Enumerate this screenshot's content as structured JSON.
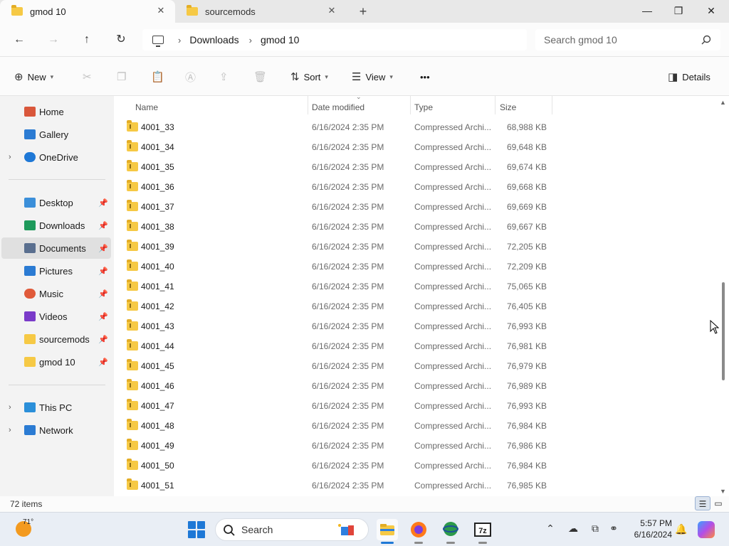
{
  "tabs": [
    {
      "label": "gmod 10",
      "active": true
    },
    {
      "label": "sourcemods",
      "active": false
    }
  ],
  "window_controls": {
    "minimize": "—",
    "maximize": "❐",
    "close": "✕"
  },
  "address": {
    "breadcrumbs": [
      "Downloads",
      "gmod 10"
    ],
    "search_placeholder": "Search gmod 10"
  },
  "commandbar": {
    "new": "New",
    "sort": "Sort",
    "view": "View",
    "more": "•••",
    "details": "Details"
  },
  "sidebar": {
    "top": [
      {
        "label": "Home",
        "icon": "home-icon",
        "color": "#d9573b"
      },
      {
        "label": "Gallery",
        "icon": "gallery-icon",
        "color": "#2b7bd3"
      },
      {
        "label": "OneDrive",
        "icon": "cloud-icon",
        "color": "#1e78d6",
        "expandable": true
      }
    ],
    "quick": [
      {
        "label": "Desktop",
        "icon": "desktop-icon",
        "color": "#3b8fd9",
        "pinned": true
      },
      {
        "label": "Downloads",
        "icon": "download-icon",
        "color": "#1e9a5b",
        "pinned": true
      },
      {
        "label": "Documents",
        "icon": "document-icon",
        "color": "#5a6f8f",
        "pinned": true,
        "selected": true
      },
      {
        "label": "Pictures",
        "icon": "pictures-icon",
        "color": "#2b7bd3",
        "pinned": true
      },
      {
        "label": "Music",
        "icon": "music-icon",
        "color": "#e05a3a",
        "pinned": true
      },
      {
        "label": "Videos",
        "icon": "videos-icon",
        "color": "#7a3bc9",
        "pinned": true
      },
      {
        "label": "sourcemods",
        "icon": "folder-icon",
        "color": "#f6c945",
        "pinned": true
      },
      {
        "label": "gmod 10",
        "icon": "folder-icon",
        "color": "#f6c945",
        "pinned": true
      }
    ],
    "bottom": [
      {
        "label": "This PC",
        "icon": "pc-icon",
        "color": "#2b8fd9",
        "expandable": true
      },
      {
        "label": "Network",
        "icon": "network-icon",
        "color": "#2b7bd3",
        "expandable": true
      }
    ]
  },
  "columns": {
    "name": "Name",
    "date": "Date modified",
    "type": "Type",
    "size": "Size"
  },
  "files": [
    {
      "name": "4001_33",
      "date": "6/16/2024 2:35 PM",
      "type": "Compressed Archi...",
      "size": "68,988 KB"
    },
    {
      "name": "4001_34",
      "date": "6/16/2024 2:35 PM",
      "type": "Compressed Archi...",
      "size": "69,648 KB"
    },
    {
      "name": "4001_35",
      "date": "6/16/2024 2:35 PM",
      "type": "Compressed Archi...",
      "size": "69,674 KB"
    },
    {
      "name": "4001_36",
      "date": "6/16/2024 2:35 PM",
      "type": "Compressed Archi...",
      "size": "69,668 KB"
    },
    {
      "name": "4001_37",
      "date": "6/16/2024 2:35 PM",
      "type": "Compressed Archi...",
      "size": "69,669 KB"
    },
    {
      "name": "4001_38",
      "date": "6/16/2024 2:35 PM",
      "type": "Compressed Archi...",
      "size": "69,667 KB"
    },
    {
      "name": "4001_39",
      "date": "6/16/2024 2:35 PM",
      "type": "Compressed Archi...",
      "size": "72,205 KB"
    },
    {
      "name": "4001_40",
      "date": "6/16/2024 2:35 PM",
      "type": "Compressed Archi...",
      "size": "72,209 KB"
    },
    {
      "name": "4001_41",
      "date": "6/16/2024 2:35 PM",
      "type": "Compressed Archi...",
      "size": "75,065 KB"
    },
    {
      "name": "4001_42",
      "date": "6/16/2024 2:35 PM",
      "type": "Compressed Archi...",
      "size": "76,405 KB"
    },
    {
      "name": "4001_43",
      "date": "6/16/2024 2:35 PM",
      "type": "Compressed Archi...",
      "size": "76,993 KB"
    },
    {
      "name": "4001_44",
      "date": "6/16/2024 2:35 PM",
      "type": "Compressed Archi...",
      "size": "76,981 KB"
    },
    {
      "name": "4001_45",
      "date": "6/16/2024 2:35 PM",
      "type": "Compressed Archi...",
      "size": "76,979 KB"
    },
    {
      "name": "4001_46",
      "date": "6/16/2024 2:35 PM",
      "type": "Compressed Archi...",
      "size": "76,989 KB"
    },
    {
      "name": "4001_47",
      "date": "6/16/2024 2:35 PM",
      "type": "Compressed Archi...",
      "size": "76,993 KB"
    },
    {
      "name": "4001_48",
      "date": "6/16/2024 2:35 PM",
      "type": "Compressed Archi...",
      "size": "76,984 KB"
    },
    {
      "name": "4001_49",
      "date": "6/16/2024 2:35 PM",
      "type": "Compressed Archi...",
      "size": "76,986 KB"
    },
    {
      "name": "4001_50",
      "date": "6/16/2024 2:35 PM",
      "type": "Compressed Archi...",
      "size": "76,984 KB"
    },
    {
      "name": "4001_51",
      "date": "6/16/2024 2:35 PM",
      "type": "Compressed Archi...",
      "size": "76,985 KB"
    }
  ],
  "status": {
    "item_count": "72 items"
  },
  "taskbar": {
    "temperature": "71°",
    "search_label": "Search",
    "time": "5:57 PM",
    "date": "6/16/2024",
    "apps": [
      "file-explorer-icon",
      "firefox-icon",
      "network-globe-icon",
      "7zip-icon"
    ],
    "accent": "#1e78d6"
  }
}
